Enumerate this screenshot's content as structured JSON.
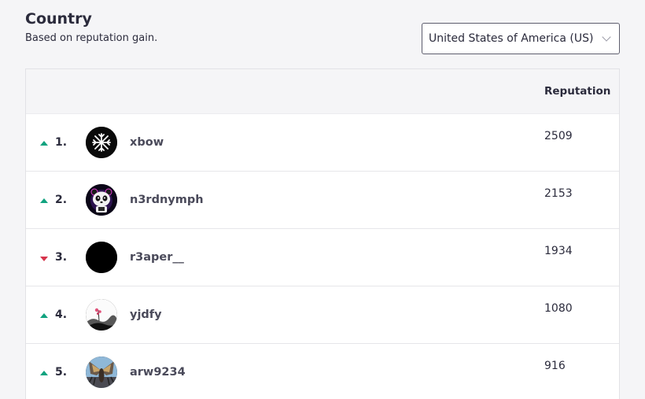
{
  "header": {
    "title": "Country",
    "subtitle": "Based on reputation gain."
  },
  "country_select": {
    "value": "United States of America (US)",
    "icon": "chevron-down-icon"
  },
  "table": {
    "columns": {
      "reputation": "Reputation"
    },
    "rows": [
      {
        "trend": "up",
        "rank": "1.",
        "username": "xbow",
        "reputation": "2509",
        "avatar": "xbow-logo-avatar"
      },
      {
        "trend": "up",
        "rank": "2.",
        "username": "n3rdnymph",
        "reputation": "2153",
        "avatar": "panda-avatar"
      },
      {
        "trend": "down",
        "rank": "3.",
        "username": "r3aper__",
        "reputation": "1934",
        "avatar": "black-avatar"
      },
      {
        "trend": "up",
        "rank": "4.",
        "username": "yjdfy",
        "reputation": "1080",
        "avatar": "ink-painting-avatar"
      },
      {
        "trend": "up",
        "rank": "5.",
        "username": "arw9234",
        "reputation": "916",
        "avatar": "mothra-avatar"
      }
    ]
  },
  "colors": {
    "trend_up": "#11a37f",
    "trend_down": "#d6334b"
  }
}
